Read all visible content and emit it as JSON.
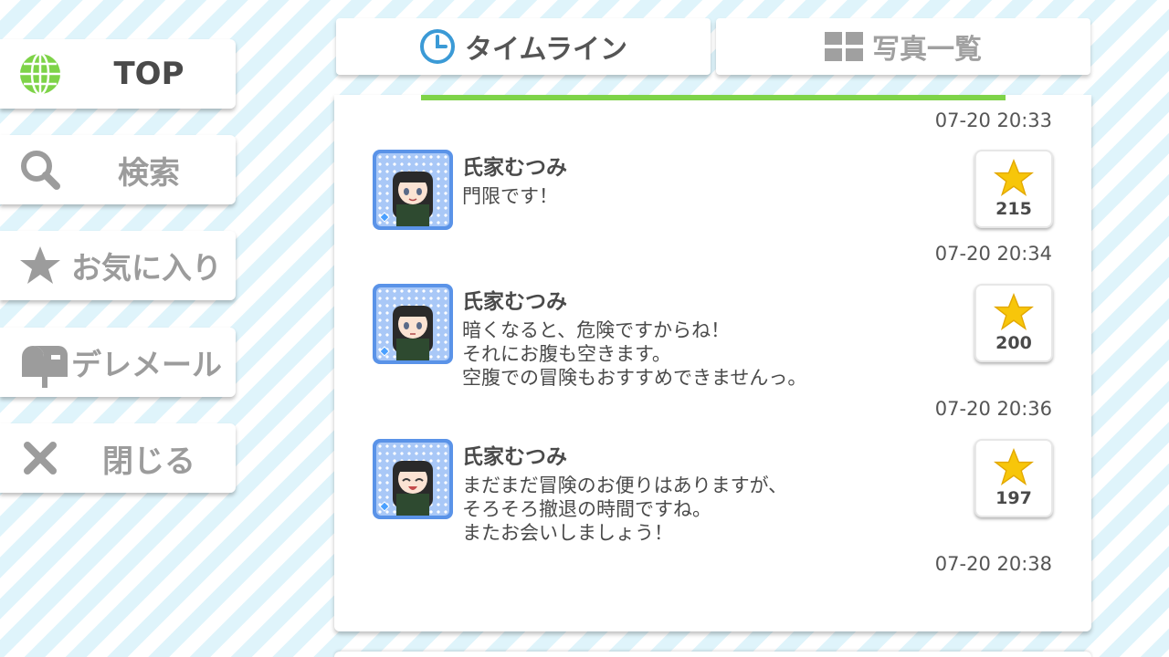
{
  "sidebar": {
    "items": [
      {
        "label": "TOP",
        "icon": "globe-icon"
      },
      {
        "label": "検索",
        "icon": "search-icon"
      },
      {
        "label": "お気に入り",
        "icon": "star-icon"
      },
      {
        "label": "デレメール",
        "icon": "mailbox-icon"
      },
      {
        "label": "閉じる",
        "icon": "close-icon"
      }
    ]
  },
  "tabs": [
    {
      "label": "タイムライン",
      "icon": "clock-icon",
      "active": true
    },
    {
      "label": "写真一覧",
      "icon": "grid-icon",
      "active": false
    }
  ],
  "progress": {
    "fraction": 1.0,
    "color": "#7ed348"
  },
  "timeline": {
    "timestamps": [
      "07-20 20:33",
      "07-20 20:34",
      "07-20 20:36",
      "07-20 20:38"
    ],
    "posts": [
      {
        "author": "氏家むつみ",
        "message": "門限です！",
        "likes": "215",
        "expression": "smile"
      },
      {
        "author": "氏家むつみ",
        "message": "暗くなると、危険ですからね！\nそれにお腹も空きます。\n空腹での冒険もおすすめできませんっ。",
        "likes": "200",
        "expression": "neutral"
      },
      {
        "author": "氏家むつみ",
        "message": "まだまだ冒険のお便りはありますが、\nそろそろ撤退の時間ですね。\nまたお会いしましょう！",
        "likes": "197",
        "expression": "laugh"
      }
    ]
  },
  "colors": {
    "accent_green": "#7ed348",
    "avatar_border": "#5a93e8",
    "star": "#f7c60a",
    "text": "#4a4a4a",
    "inactive": "#9c9c9c"
  }
}
